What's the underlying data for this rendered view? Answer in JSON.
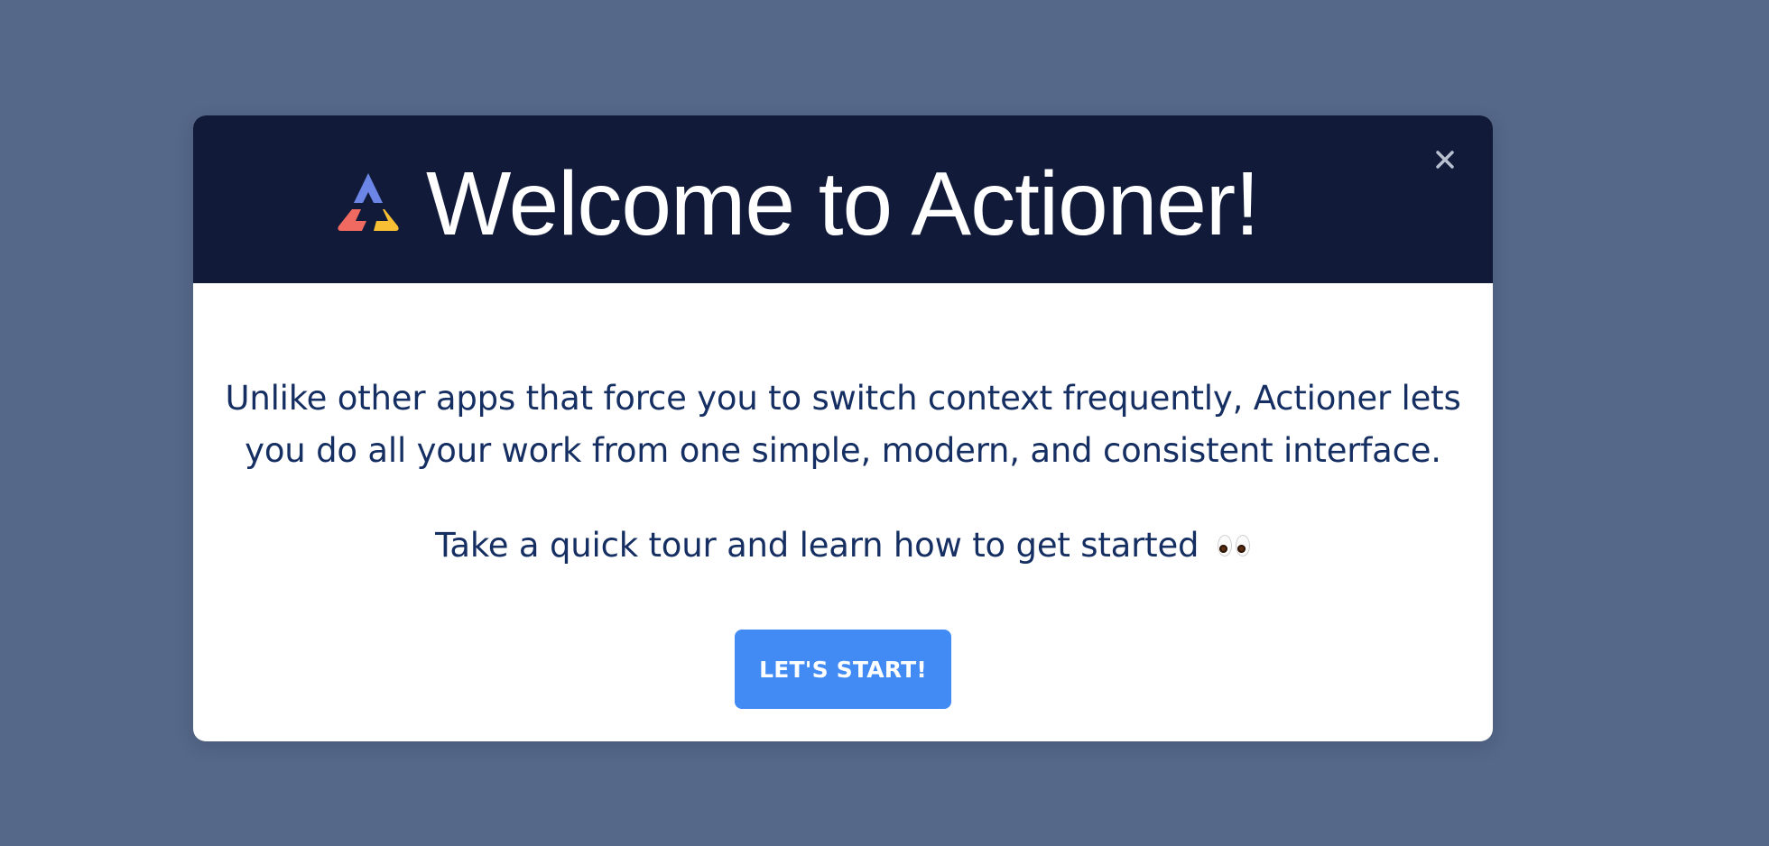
{
  "modal": {
    "title": "Welcome to Actioner!",
    "body": {
      "intro": "Unlike other apps that force you to switch context frequently, Actioner lets you do all your work from one simple, modern, and consistent interface.",
      "tour_text": "Take a quick tour and learn how to get started"
    },
    "cta": {
      "label": "LET'S START!"
    }
  },
  "icons": {
    "logo": "actioner-logo-icon",
    "close": "close-icon",
    "eyes": "eyes-icon"
  },
  "colors": {
    "background": "#566889",
    "header": "#111b39",
    "text": "#162f63",
    "button": "#428bf4",
    "logo_blue": "#6b86e6",
    "logo_red": "#f16a62",
    "logo_yellow": "#f7bf34"
  }
}
